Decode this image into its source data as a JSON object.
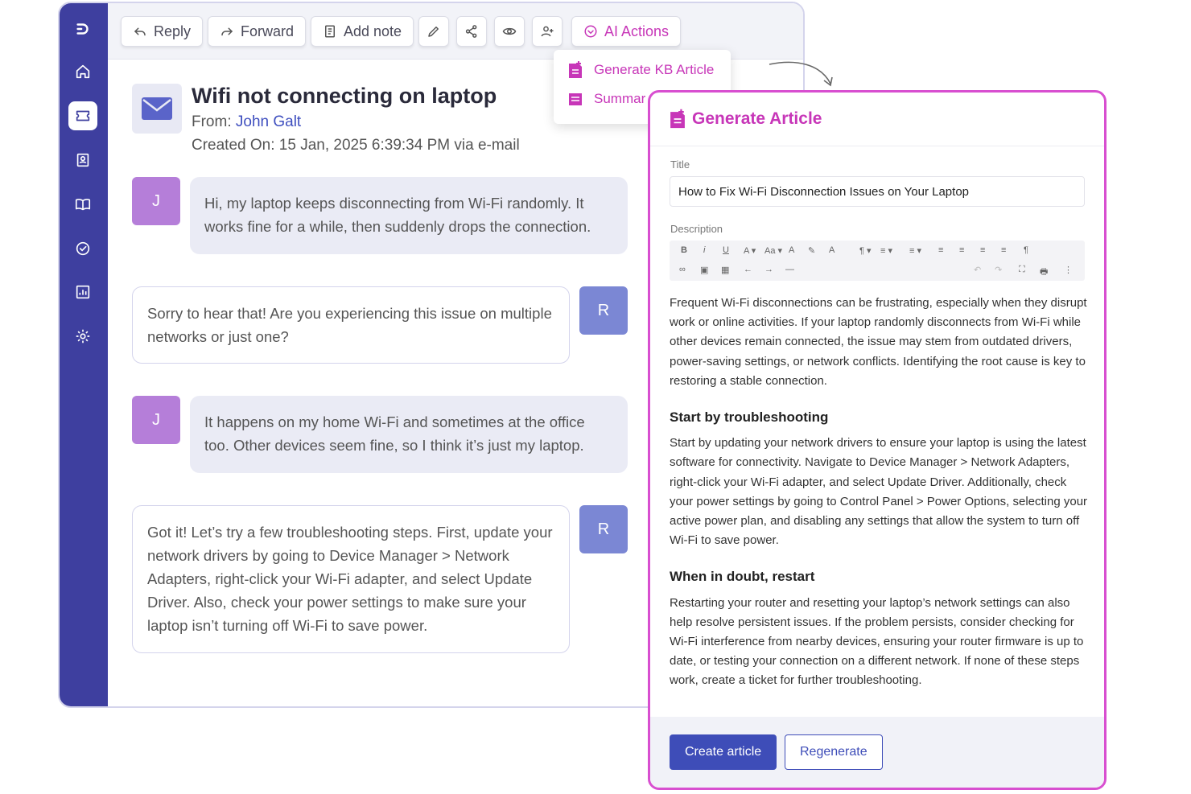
{
  "toolbar": {
    "reply": "Reply",
    "forward": "Forward",
    "add_note": "Add note",
    "ai_actions": "AI Actions",
    "icons": [
      "pencil-icon",
      "share-icon",
      "eye-icon",
      "assign-user-icon"
    ]
  },
  "sidebar": {
    "items": [
      "logo",
      "home",
      "tickets",
      "contacts",
      "knowledge-base",
      "tasks",
      "reports",
      "settings"
    ],
    "active": "tickets"
  },
  "ticket": {
    "title": "Wifi not connecting on laptop",
    "from_label": "From:",
    "from_name": "John Galt",
    "created": "Created On: 15 Jan, 2025 6:39:34 PM via e-mail"
  },
  "messages": [
    {
      "author": "J",
      "text": "Hi, my laptop keeps disconnecting from Wi-Fi randomly. It works fine for a while, then suddenly drops the connection."
    },
    {
      "author": "R",
      "text": "Sorry to hear that! Are you experiencing this issue on multiple networks or just one?"
    },
    {
      "author": "J",
      "text": "It happens on my home Wi-Fi and sometimes at the office too. Other devices seem fine, so I think it’s just my laptop."
    },
    {
      "author": "R",
      "text": "Got it! Let’s try a few troubleshooting steps. First, update your network drivers by going to Device Manager > Network Adapters, right-click your Wi-Fi adapter, and select Update Driver. Also, check your power settings to make sure your laptop isn’t turning off Wi-Fi to save power."
    }
  ],
  "ai_menu": {
    "items": [
      "Generate KB Article",
      "Summar"
    ]
  },
  "panel": {
    "title": "Generate Article",
    "title_label": "Title",
    "title_value": "How to Fix Wi-Fi Disconnection Issues on Your Laptop",
    "description_label": "Description",
    "intro": "Frequent Wi-Fi disconnections can be frustrating, especially when they disrupt work or online activities. If your laptop randomly disconnects from Wi-Fi while other devices remain connected, the issue may stem from outdated drivers, power-saving settings, or network conflicts. Identifying the root cause is key to restoring a stable connection.",
    "section1_heading": "Start by troubleshooting",
    "section1_body": "Start by updating your network drivers to ensure your laptop is using the latest software for connectivity. Navigate to Device Manager > Network Adapters, right-click your Wi-Fi adapter, and select Update Driver. Additionally, check your power settings by going to Control Panel > Power Options, selecting your active power plan, and disabling any settings that allow the system to turn off Wi-Fi to save power.",
    "section2_heading": "When in doubt, restart",
    "section2_body": "Restarting your router and resetting your laptop’s network settings can also help resolve persistent issues. If the problem persists, consider checking for Wi-Fi interference from nearby devices, ensuring your router firmware is up to date, or testing your connection on a different network. If none of these steps work, create a ticket for further troubleshooting.",
    "create_button": "Create article",
    "regenerate_button": "Regenerate",
    "editor_row1": [
      "B",
      "i",
      "U",
      "A ▾",
      "Aa ▾",
      "A",
      "✎",
      "A",
      "¶ ▾",
      "≡ ▾",
      "≡ ▾",
      "≡",
      "≡",
      "≡",
      "≡",
      "¶"
    ],
    "editor_row2": [
      "∞",
      "▣",
      "▦",
      "←",
      "→",
      "—",
      "↶",
      "↷",
      "⛶",
      "🖶",
      "⋮"
    ]
  },
  "colors": {
    "sidebar": "#3e3f9f",
    "accent_magenta": "#c736b8",
    "primary_blue": "#3e4db8",
    "avatar_customer": "#b57ed9",
    "avatar_agent": "#7b87d4"
  }
}
